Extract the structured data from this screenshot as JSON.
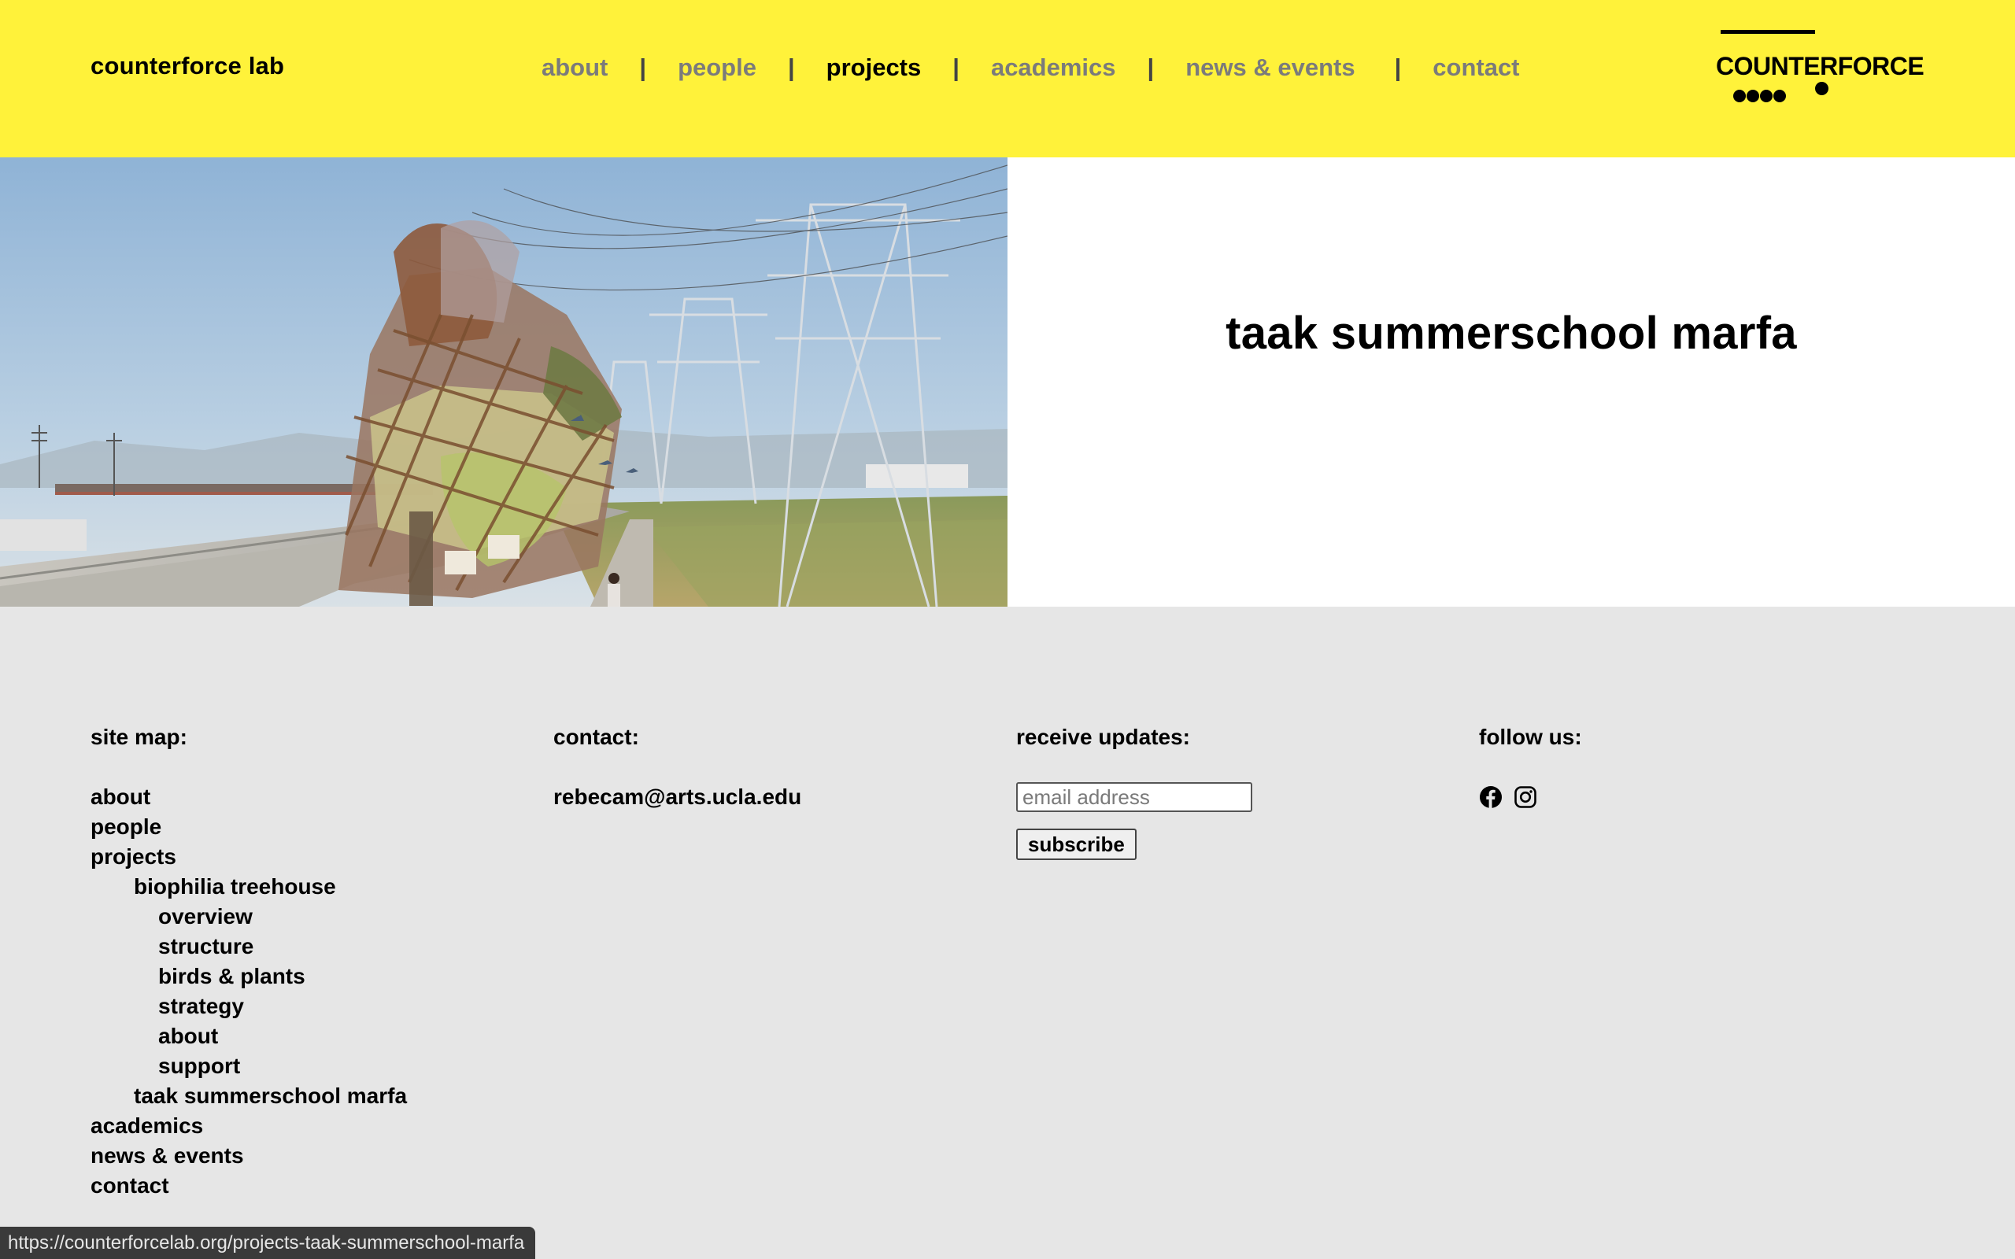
{
  "header": {
    "site_title": "counterforce lab",
    "nav": [
      {
        "label": "about",
        "active": false
      },
      {
        "label": "people",
        "active": false
      },
      {
        "label": "projects",
        "active": true
      },
      {
        "label": "academics",
        "active": false
      },
      {
        "label": "news & events",
        "active": false
      },
      {
        "label": "contact",
        "active": false
      }
    ],
    "nav_separator": "|",
    "logo_text": "COUNTERFORCE",
    "background_color": "#fff23a"
  },
  "hero": {
    "image_alt": "rendering of biophilia treehouse structure beside the LA river under power lines",
    "project_title": "taak summerschool marfa"
  },
  "footer": {
    "sitemap": {
      "heading": "site map:",
      "items": [
        {
          "label": "about",
          "level": 0
        },
        {
          "label": "people",
          "level": 0
        },
        {
          "label": "projects",
          "level": 0
        },
        {
          "label": "biophilia treehouse",
          "level": 1
        },
        {
          "label": "overview",
          "level": 2
        },
        {
          "label": "structure",
          "level": 2
        },
        {
          "label": "birds & plants",
          "level": 2
        },
        {
          "label": "strategy",
          "level": 2
        },
        {
          "label": "about",
          "level": 2
        },
        {
          "label": "support",
          "level": 2
        },
        {
          "label": "taak summerschool marfa",
          "level": 1
        },
        {
          "label": "academics",
          "level": 0
        },
        {
          "label": "news & events",
          "level": 0
        },
        {
          "label": "contact",
          "level": 0
        }
      ]
    },
    "contact": {
      "heading": "contact:",
      "email": "rebecam@arts.ucla.edu"
    },
    "updates": {
      "heading": "receive updates:",
      "email_placeholder": "email address",
      "email_value": "",
      "subscribe_label": "subscribe"
    },
    "follow": {
      "heading": "follow us:",
      "icons": [
        "facebook-icon",
        "instagram-icon"
      ]
    }
  },
  "status_bar": {
    "url": "https://counterforcelab.org/projects-taak-summerschool-marfa"
  }
}
